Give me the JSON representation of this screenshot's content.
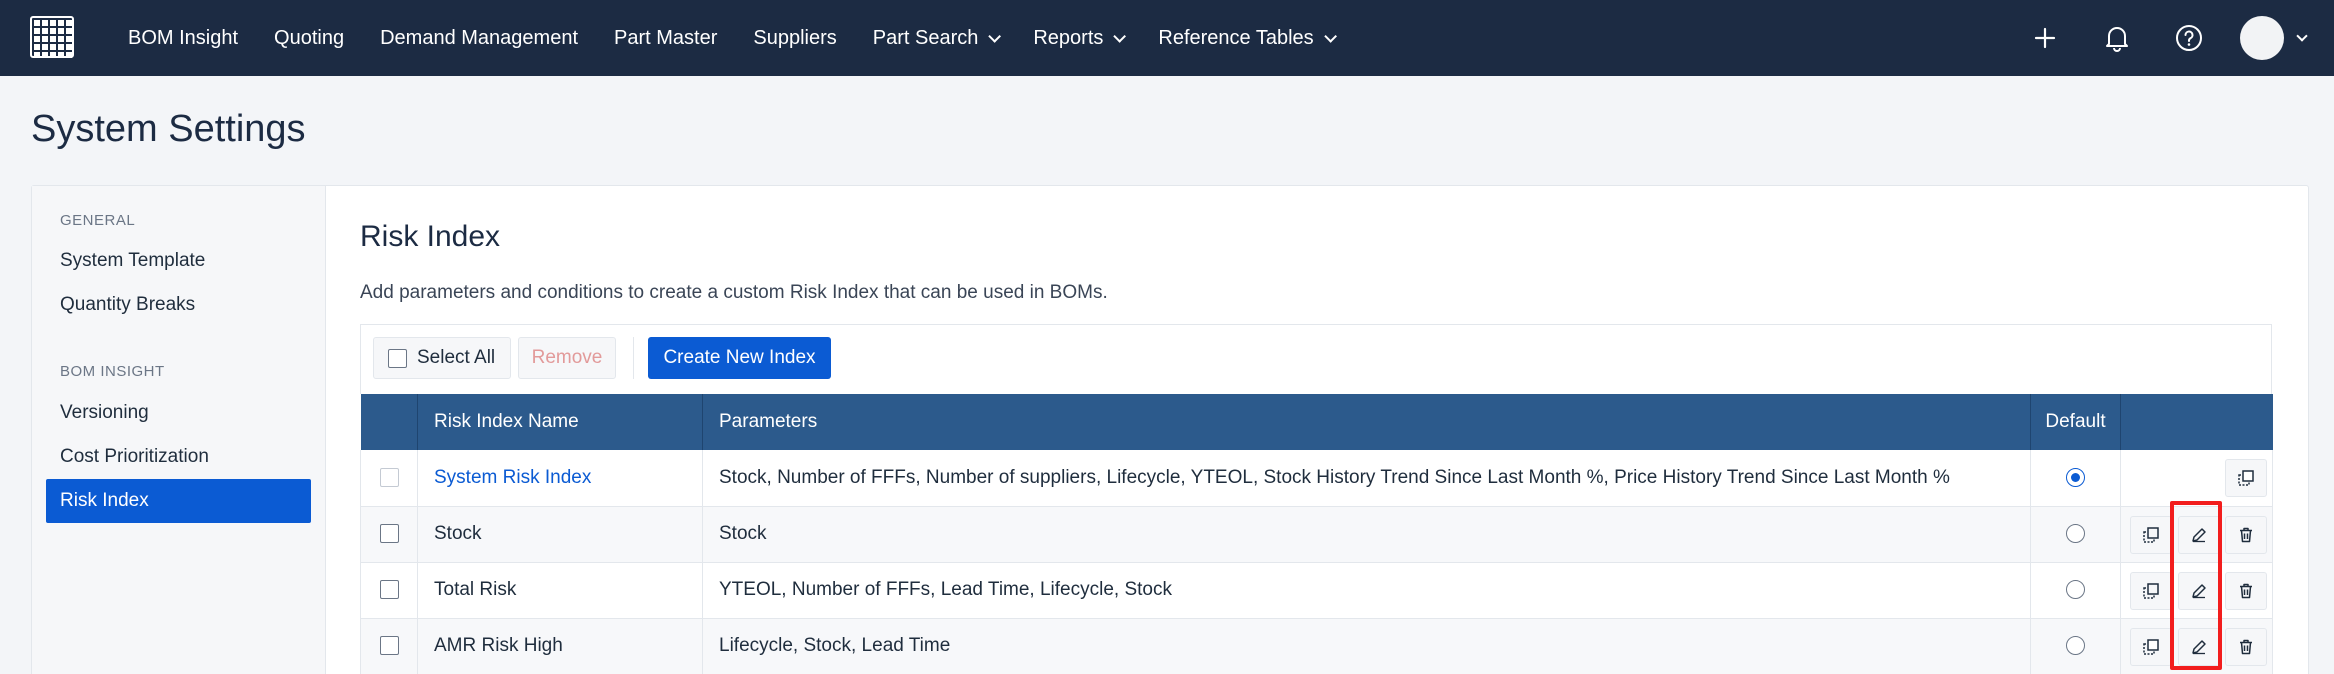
{
  "nav": {
    "items": [
      {
        "label": "BOM Insight",
        "dropdown": false
      },
      {
        "label": "Quoting",
        "dropdown": false
      },
      {
        "label": "Demand Management",
        "dropdown": false
      },
      {
        "label": "Part Master",
        "dropdown": false
      },
      {
        "label": "Suppliers",
        "dropdown": false
      },
      {
        "label": "Part Search",
        "dropdown": true
      },
      {
        "label": "Reports",
        "dropdown": true
      },
      {
        "label": "Reference Tables",
        "dropdown": true
      }
    ],
    "icons": [
      "plus-icon",
      "bell-icon",
      "help-icon",
      "avatar"
    ]
  },
  "page": {
    "title": "System Settings"
  },
  "sidebar": {
    "sections": [
      {
        "heading": "GENERAL",
        "items": [
          "System Template",
          "Quantity Breaks"
        ]
      },
      {
        "heading": "BOM INSIGHT",
        "items": [
          "Versioning",
          "Cost Prioritization",
          "Risk Index"
        ]
      }
    ],
    "active": "Risk Index"
  },
  "main": {
    "title": "Risk Index",
    "description": "Add parameters and conditions to create a custom Risk Index that can be used in BOMs.",
    "toolbar": {
      "select_all": "Select All",
      "remove": "Remove",
      "create": "Create New Index"
    },
    "table": {
      "columns": [
        "",
        "Risk Index Name",
        "Parameters",
        "Default",
        ""
      ],
      "rows": [
        {
          "name": "System Risk Index",
          "parameters": "Stock, Number of FFFs, Number of suppliers, Lifecycle, YTEOL, Stock History Trend Since Last Month %, Price History Trend Since Last Month %",
          "default": true,
          "is_system": true
        },
        {
          "name": "Stock",
          "parameters": "Stock",
          "default": false,
          "is_system": false
        },
        {
          "name": "Total Risk",
          "parameters": "YTEOL, Number of FFFs, Lead Time, Lifecycle, Stock",
          "default": false,
          "is_system": false
        },
        {
          "name": "AMR Risk High",
          "parameters": "Lifecycle, Stock, Lead Time",
          "default": false,
          "is_system": false
        }
      ]
    }
  },
  "colors": {
    "topbar": "#1c2b43",
    "accent": "#0b5bd3",
    "table_header": "#2c5a8c",
    "highlight": "#f21d1d"
  }
}
